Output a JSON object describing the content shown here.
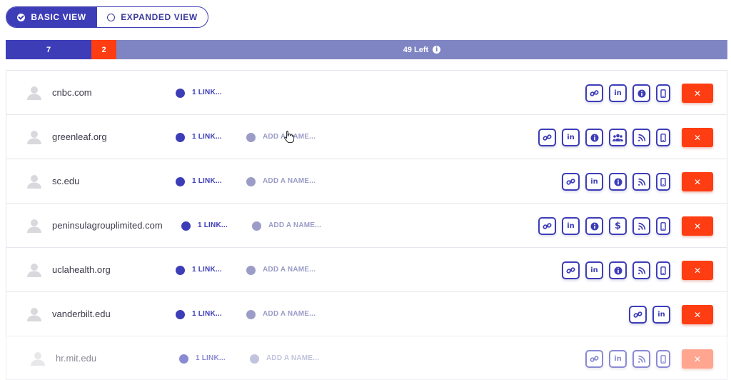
{
  "view_toggle": {
    "basic_label": "BASIC VIEW",
    "expanded_label": "EXPANDED VIEW",
    "selected": "basic"
  },
  "progress": {
    "blue_count": "7",
    "red_count": "2",
    "remaining_label": "49 Left",
    "info_icon": "info-icon"
  },
  "rows": [
    {
      "domain": "cnbc.com",
      "link_label": "1 LINK...",
      "name_label": "",
      "icons": [
        "link-icon",
        "linkedin-icon",
        "info-icon",
        "phone-icon"
      ]
    },
    {
      "domain": "greenleaf.org",
      "link_label": "1 LINK...",
      "name_label": "ADD A NAME...",
      "icons": [
        "link-icon",
        "linkedin-icon",
        "info-icon",
        "group-icon",
        "rss-icon",
        "phone-icon"
      ]
    },
    {
      "domain": "sc.edu",
      "link_label": "1 LINK...",
      "name_label": "ADD A NAME...",
      "icons": [
        "link-icon",
        "linkedin-icon",
        "info-icon",
        "rss-icon",
        "phone-icon"
      ]
    },
    {
      "domain": "peninsulagrouplimited.com",
      "link_label": "1 LINK...",
      "name_label": "ADD A NAME...",
      "icons": [
        "link-icon",
        "linkedin-icon",
        "info-icon",
        "dollar-icon",
        "rss-icon",
        "phone-icon"
      ]
    },
    {
      "domain": "uclahealth.org",
      "link_label": "1 LINK...",
      "name_label": "ADD A NAME...",
      "icons": [
        "link-icon",
        "linkedin-icon",
        "info-icon",
        "rss-icon",
        "phone-icon"
      ]
    },
    {
      "domain": "vanderbilt.edu",
      "link_label": "1 LINK...",
      "name_label": "ADD A NAME...",
      "icons": [
        "link-icon",
        "linkedin-icon"
      ]
    },
    {
      "domain": "hr.mit.edu",
      "link_label": "1 LINK...",
      "name_label": "ADD A NAME...",
      "icons": [
        "link-icon",
        "linkedin-icon",
        "rss-icon",
        "phone-icon"
      ]
    }
  ],
  "delete_label": "✕",
  "colors": {
    "primary": "#3d3db8",
    "danger": "#ff3d12",
    "progress_rest": "#7f85c3",
    "muted": "#9b9cc7"
  }
}
